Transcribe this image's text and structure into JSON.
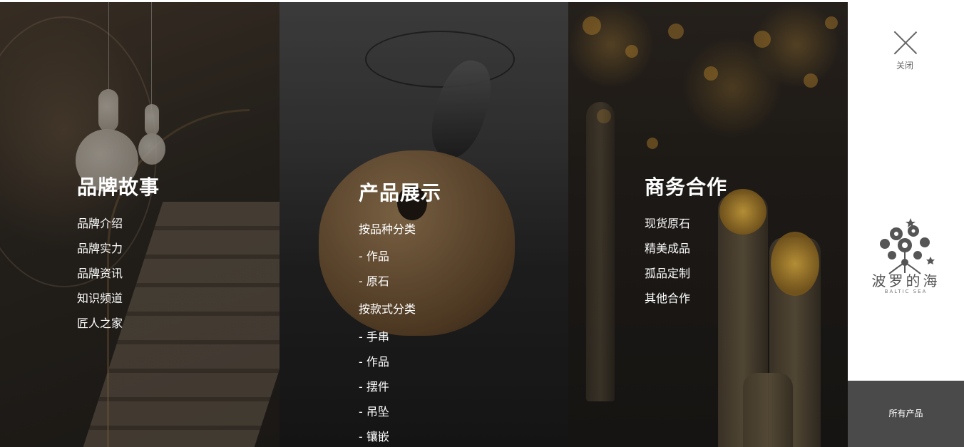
{
  "columns": [
    {
      "title": "品牌故事",
      "links": [
        "品牌介绍",
        "品牌实力",
        "品牌资讯",
        "知识频道",
        "匠人之家"
      ]
    },
    {
      "title": "产品展示",
      "group1": "按品种分类",
      "group1_items": [
        "- 作品",
        "- 原石"
      ],
      "group2": "按款式分类",
      "group2_items": [
        "- 手串",
        "- 作品",
        "- 摆件",
        "- 吊坠",
        "- 镶嵌"
      ]
    },
    {
      "title": "商务合作",
      "links": [
        "现货原石",
        "精美成品",
        "孤品定制",
        "其他合作"
      ]
    }
  ],
  "sidebar": {
    "close_label": "关闭",
    "logo_cn": "波罗的海",
    "logo_en": "BALTIC SEA",
    "all_products": "所有产品"
  },
  "colors": {
    "sidebar_bottom": "#4a4a4a",
    "text": "#ffffff"
  },
  "icons": {
    "close": "close-icon",
    "logo": "flower-logo-icon"
  }
}
